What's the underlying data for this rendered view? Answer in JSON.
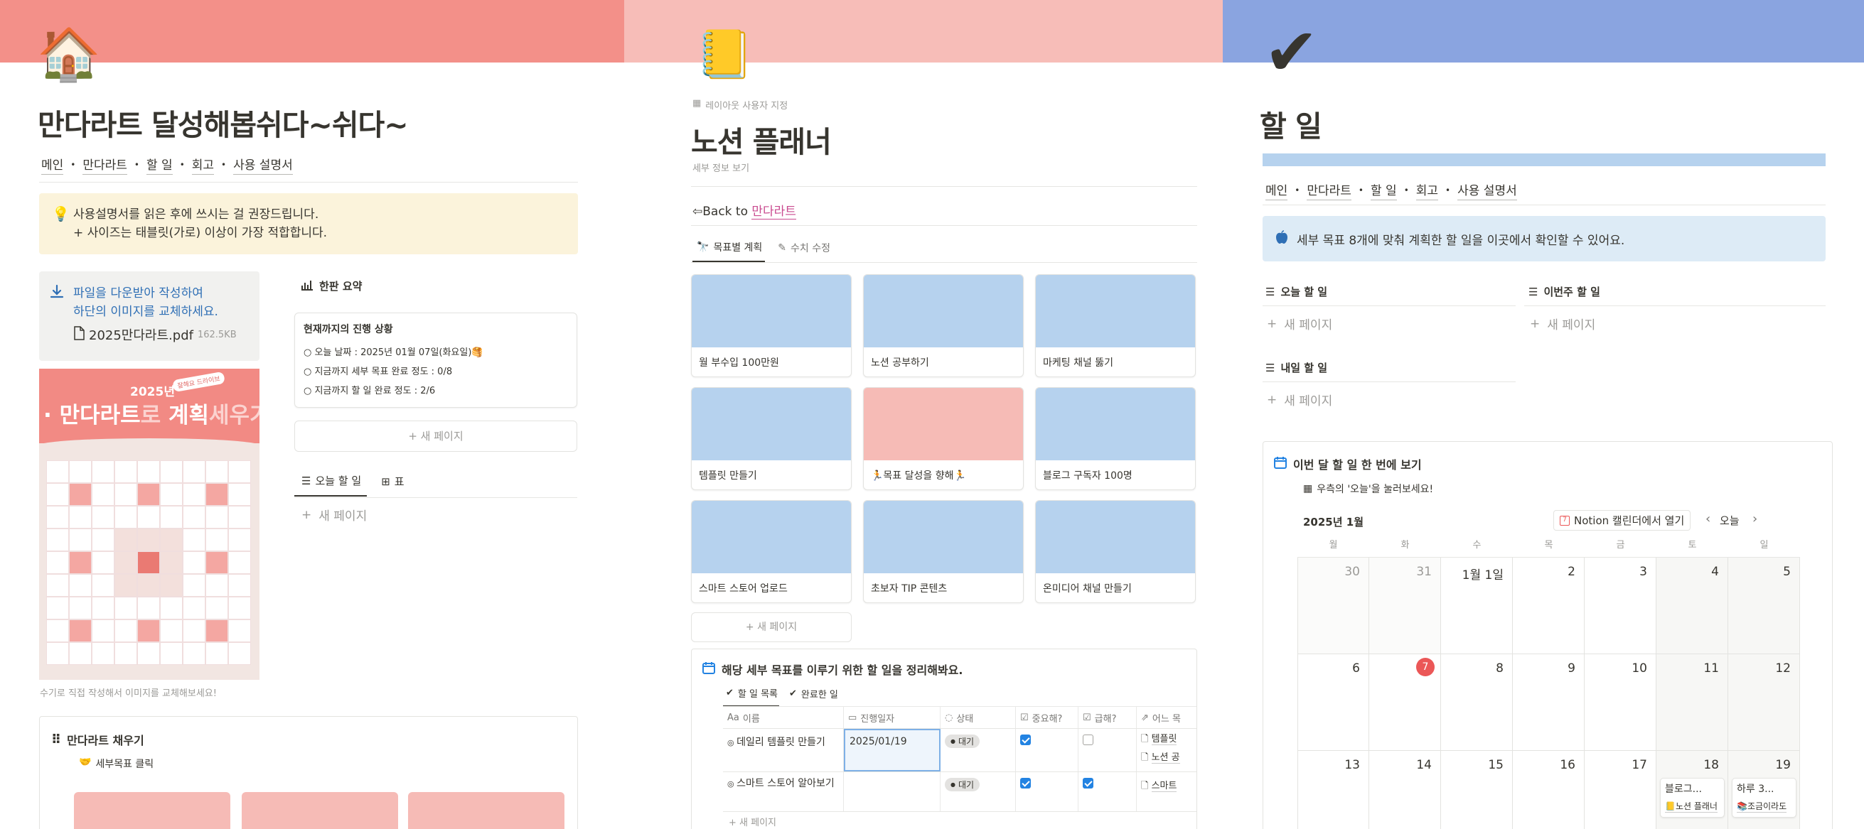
{
  "colors": {
    "cover1": "#f39089",
    "cover2": "#f7bdb8",
    "cover3": "#8aa4e0",
    "callout_yellow": "#fbf3db",
    "callout_blue": "#ddebf6",
    "card_blue": "#b6d2ee",
    "card_pink": "#f6bbb6",
    "today_red": "#eb5757",
    "accent_pink": "#c94a8f"
  },
  "panel1": {
    "icon": "🏠",
    "title": "만다라트 달성해봅쉬다~쉬다~",
    "nav": [
      "메인",
      "만다라트",
      "할 일",
      "회고",
      "사용 설명서"
    ],
    "callout_lines": [
      "사용설명서를 읽은 후에 쓰시는 걸 권장드립니다.",
      "+ 사이즈는 태블릿(가로) 이상이 가장 적합합니다."
    ],
    "download": {
      "lines": [
        "파일을 다운받아 작성하여",
        "하단의 이미지를 교체하세요."
      ],
      "file_name": "2025만다라트.pdf",
      "file_size": "162.5KB"
    },
    "poster": {
      "year": "2025년",
      "badge": "잘해요 드라이브",
      "title_a": "· 만다라트",
      "title_b": "로 ",
      "title_c": "계획",
      "title_d": "세우기 ·"
    },
    "caption": "수기로 직접 작성해서 이미지를 교체해보세요!",
    "summary": {
      "header": "한판 요약",
      "card_title": "현재까지의 진행 상황",
      "rows": [
        "○ 오늘 날짜 : 2025년 01월 07일(화요일)🥞",
        "○ 지금까지 세부 목표 완료 정도 : 0/8",
        "○ 지금까지 할 일 완료 정도 : 2/6"
      ],
      "new_page": "+ 새 페이지"
    },
    "today_tabs": [
      "오늘 할 일",
      "표"
    ],
    "new_page": "새 페이지",
    "mandalart": {
      "header": "만다라트 채우기",
      "sub": "세부목표 클릭"
    }
  },
  "panel2": {
    "icon": "📒",
    "layout_label": "레이아웃 사용자 지정",
    "title": "노션 플래너",
    "subtitle": "세부 정보 보기",
    "back_text": "⇦Back to ",
    "back_link": "만다라트",
    "tabs": [
      "목표별 계획",
      "수치 수정"
    ],
    "cards": [
      {
        "label": "월 부수입 100만원",
        "color": "blue"
      },
      {
        "label": "노션 공부하기",
        "color": "blue"
      },
      {
        "label": "마케팅 채널 뚫기",
        "color": "blue"
      },
      {
        "label": "템플릿 만들기",
        "color": "blue"
      },
      {
        "label": "🏃목표 달성을 향해🏃",
        "color": "pink"
      },
      {
        "label": "블로그 구독자 100명",
        "color": "blue"
      },
      {
        "label": "스마트 스토어 업로드",
        "color": "blue"
      },
      {
        "label": "초보자 TIP 콘텐츠",
        "color": "blue"
      },
      {
        "label": "온미디어 채널 만들기",
        "color": "blue"
      }
    ],
    "new_page": "+ 새 페이지",
    "todo_box": {
      "title": "해당 세부 목표를 이루기 위한 할 일을 정리해봐요.",
      "tabs": [
        "할 일 목록",
        "완료한 일"
      ],
      "columns": [
        "이름",
        "진행일자",
        "상태",
        "중요해?",
        "급해?",
        "어느 목"
      ],
      "rows": [
        {
          "name": "데일리 템플릿 만들기",
          "date": "2025/01/19",
          "status": "대기",
          "important": true,
          "urgent": false,
          "rel": [
            "템플릿",
            "노션 공"
          ]
        },
        {
          "name": "스마트 스토어 알아보기",
          "date": "",
          "status": "대기",
          "important": true,
          "urgent": true,
          "rel": [
            "스마트"
          ]
        }
      ],
      "new_page": "+ 새 페이지"
    }
  },
  "panel3": {
    "icon": "✔",
    "title": "할 일",
    "nav": [
      "메인",
      "만다라트",
      "할 일",
      "회고",
      "사용 설명서"
    ],
    "callout": "세부 목표 8개에 맞춰 계획한 할 일을 이곳에서 확인할 수 있어요.",
    "lists": [
      {
        "header": "오늘 할 일",
        "new": "새 페이지"
      },
      {
        "header": "이번주 할 일",
        "new": "새 페이지"
      },
      {
        "header": "내일 할 일",
        "new": "새 페이지"
      }
    ],
    "calendar": {
      "box_title": "이번 달 할 일 한 번에 보기",
      "hint": "우측의 '오늘'을 눌러보세요!",
      "month": "2025년 1월",
      "open_btn": "Notion 캘린더에서 열기",
      "today_btn": "오늘",
      "weekdays": [
        "월",
        "화",
        "수",
        "목",
        "금",
        "토",
        "일"
      ],
      "weeks": [
        [
          "30",
          "31",
          "1월 1일",
          "2",
          "3",
          "4",
          "5"
        ],
        [
          "6",
          "7",
          "8",
          "9",
          "10",
          "11",
          "12"
        ],
        [
          "13",
          "14",
          "15",
          "16",
          "17",
          "18",
          "19"
        ]
      ],
      "today": "7",
      "events": [
        {
          "title": "블로그...",
          "sub": "📒노션 플래너"
        },
        {
          "title": "하루 3...",
          "sub": "📚조금이라도"
        }
      ]
    }
  }
}
